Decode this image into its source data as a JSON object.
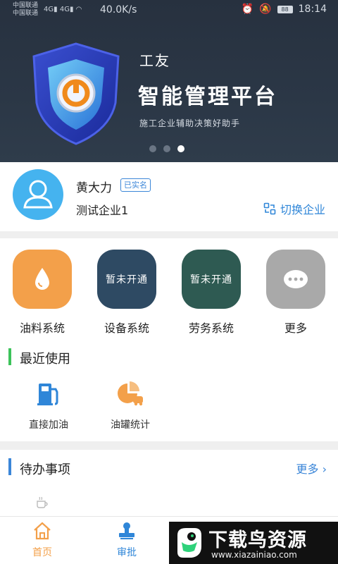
{
  "status_bar": {
    "carrier_1": "中国联通",
    "carrier_2": "中国联通",
    "signal_1": "4G",
    "signal_2": "4G",
    "net_speed": "40.0K/s",
    "battery": "88",
    "time": "18:14"
  },
  "banner": {
    "brand": "工友",
    "title": "智能管理平台",
    "subtitle": "施工企业辅助决策好助手",
    "slides": 3,
    "active_slide": 2
  },
  "user": {
    "name": "黄大力",
    "verified_label": "已实名",
    "company": "测试企业1",
    "switch_label": "切换企业"
  },
  "systems": [
    {
      "label": "油料系统",
      "overlay": "",
      "icon": "oil-drop-icon",
      "color": "#f3a04a"
    },
    {
      "label": "设备系统",
      "overlay": "暂未开通",
      "icon": "equipment-icon",
      "color": "#2e4a63"
    },
    {
      "label": "劳务系统",
      "overlay": "暂未开通",
      "icon": "labor-icon",
      "color": "#2e5a52"
    },
    {
      "label": "更多",
      "overlay": "",
      "icon": "more-dots-icon",
      "color": "#a9a9a9"
    }
  ],
  "recent": {
    "title": "最近使用",
    "items": [
      {
        "label": "直接加油",
        "icon": "fuel-pump-icon"
      },
      {
        "label": "油罐统计",
        "icon": "tank-stats-icon"
      }
    ]
  },
  "todo": {
    "title": "待办事项",
    "more_label": "更多"
  },
  "tabs": [
    {
      "label": "首页",
      "icon": "home-icon",
      "active": true
    },
    {
      "label": "审批",
      "icon": "approval-stamp-icon",
      "active": true
    }
  ],
  "watermark": {
    "title": "下载鸟资源",
    "url": "www.xiazainiao.com"
  },
  "colors": {
    "accent_blue": "#2f86d8",
    "orange": "#f3a04a",
    "recent_bar": "#3cc35a",
    "todo_bar": "#3b86d8"
  }
}
